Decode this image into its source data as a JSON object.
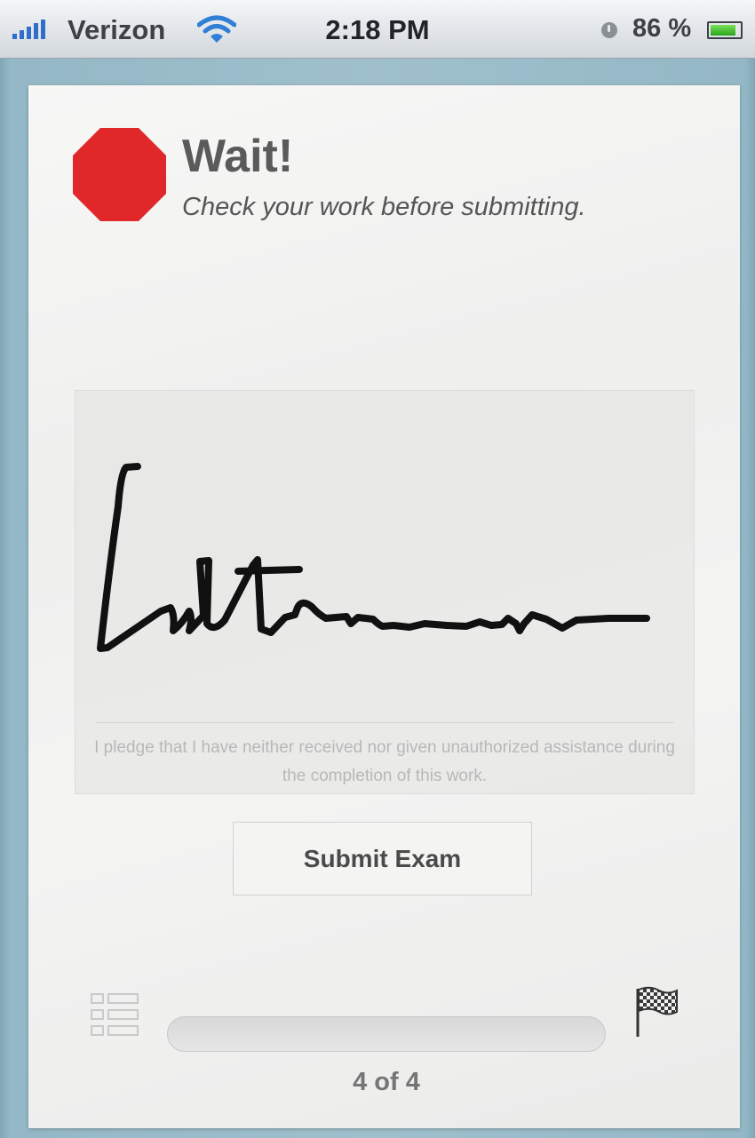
{
  "status_bar": {
    "carrier": "Verizon",
    "time": "2:18 PM",
    "battery_percent": "86 %",
    "battery_level": 0.86,
    "battery_color": "#27a51b",
    "signal_icon": "signal-bars-icon",
    "wifi_icon": "wifi-icon",
    "rotation_lock_icon": "rotation-lock-icon"
  },
  "header": {
    "title": "Wait!",
    "subtitle": "Check your work before submitting.",
    "icon": "stop-sign-icon",
    "icon_color": "#e0282a"
  },
  "signature": {
    "pledge": "I pledge that I have neither received nor given unauthorized assistance during the completion of this work."
  },
  "actions": {
    "submit_label": "Submit Exam"
  },
  "footer": {
    "list_icon": "question-list-icon",
    "flag_icon": "checkered-flag-icon",
    "page_counter": "4 of 4"
  }
}
